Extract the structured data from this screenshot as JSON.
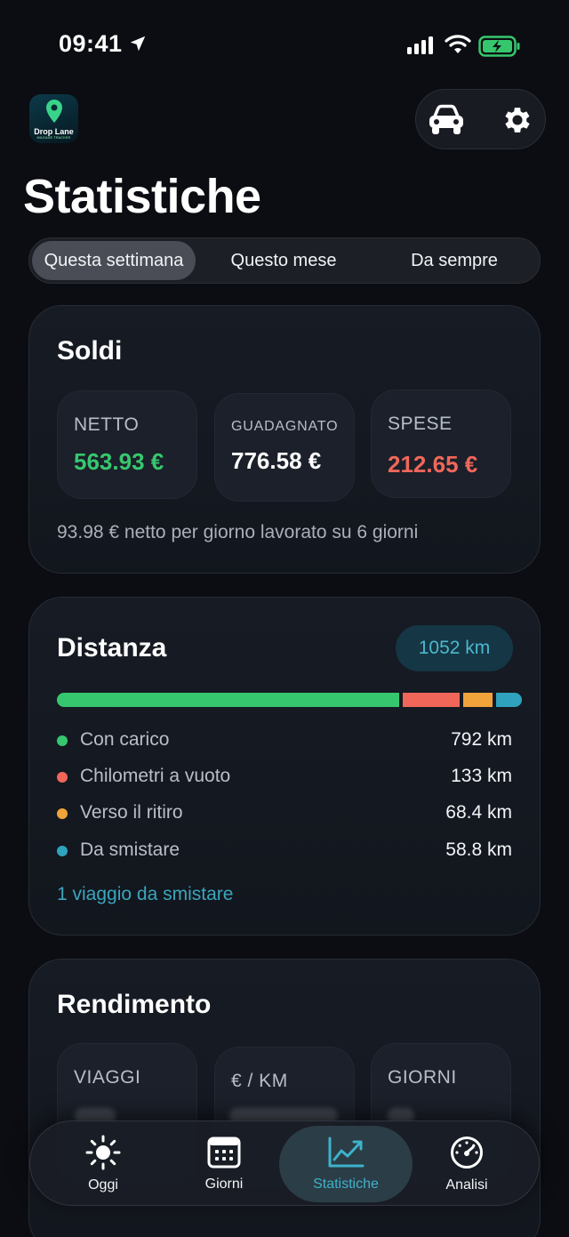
{
  "status_bar": {
    "time": "09:41"
  },
  "header": {
    "logo_text": "Drop Lane",
    "logo_subtext": "MILEAGE TRACKER",
    "title": "Statistiche"
  },
  "period_tabs": [
    {
      "label": "Questa settimana",
      "active": true
    },
    {
      "label": "Questo mese",
      "active": false
    },
    {
      "label": "Da sempre",
      "active": false
    }
  ],
  "soldi": {
    "title": "Soldi",
    "netto": {
      "label": "NETTO",
      "value": "563.93 €",
      "color": "#36c76e"
    },
    "guadagnato": {
      "label": "GUADAGNATO",
      "value": "776.58 €",
      "color": "#ffffff"
    },
    "spese": {
      "label": "SPESE",
      "value": "212.65 €",
      "color": "#f0675a"
    },
    "note": "93.98 € netto per giorno lavorato su 6 giorni"
  },
  "distanza": {
    "title": "Distanza",
    "total_badge": "1052 km",
    "items": [
      {
        "label": "Con carico",
        "value": "792 km",
        "km": 792,
        "color": "#36c76e"
      },
      {
        "label": "Chilometri a vuoto",
        "value": "133 km",
        "km": 133,
        "color": "#f0675a"
      },
      {
        "label": "Verso il ritiro",
        "value": "68.4 km",
        "km": 68.4,
        "color": "#f0a33a"
      },
      {
        "label": "Da smistare",
        "value": "58.8 km",
        "km": 58.8,
        "color": "#2fa3bd"
      }
    ],
    "link": "1 viaggio da smistare"
  },
  "rendimento": {
    "title": "Rendimento",
    "boxes": [
      {
        "label": "VIAGGI"
      },
      {
        "label": "€ / KM"
      },
      {
        "label": "GIORNI"
      }
    ]
  },
  "bottom_nav": [
    {
      "label": "Oggi",
      "icon": "sun-icon",
      "active": false
    },
    {
      "label": "Giorni",
      "icon": "calendar-icon",
      "active": false
    },
    {
      "label": "Statistiche",
      "icon": "chart-line-icon",
      "active": true
    },
    {
      "label": "Analisi",
      "icon": "speedometer-icon",
      "active": false
    }
  ]
}
